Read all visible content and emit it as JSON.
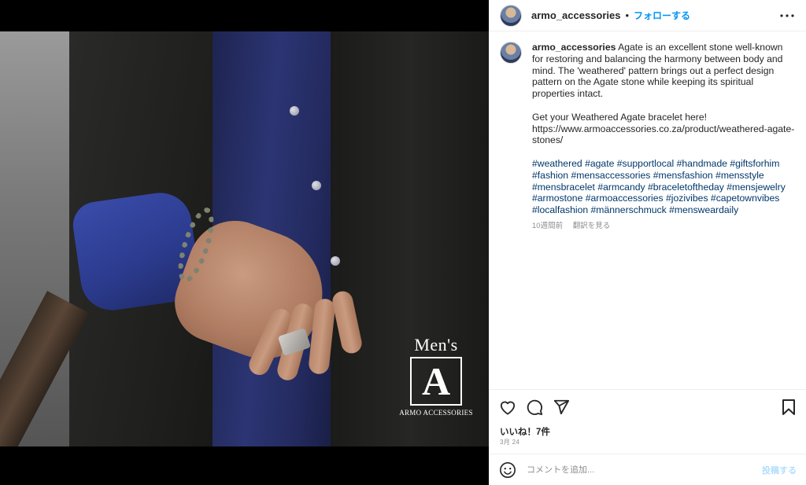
{
  "post": {
    "image_alt": "Men's hand wearing Weathered Agate bracelet and silver ring",
    "logo": {
      "line1": "Men's",
      "mark": "A",
      "brand": "ARMO ACCESSORIES"
    }
  },
  "header": {
    "username": "armo_accessories",
    "separator": "•",
    "follow_label": "フォローする",
    "more_icon": "more-horizontal-icon"
  },
  "caption": {
    "username": "armo_accessories",
    "lines": [
      "Agate is an excellent stone well-known for restoring and balancing the harmony between body and mind. The 'weathered' pattern brings out a perfect design pattern on the Agate stone while keeping its spiritual properties intact.",
      "Get your Weathered Agate bracelet here!",
      "https://www.armoaccessories.co.za/product/weathered-agate-stones/"
    ],
    "hashtags": "#weathered #agate #supportlocal #handmade #giftsforhim #fashion #mensaccessories #mensfashion #mensstyle #mensbracelet #armcandy #braceletoftheday #mensjewelry #armostone #armoaccessories #jozivibes #capetownvibes #localfashion #männerschmuck #mensweardaily",
    "time_ago": "10週間前",
    "translate_label": "翻訳を見る"
  },
  "actions": {
    "like_icon": "heart-icon",
    "comment_icon": "comment-icon",
    "share_icon": "send-icon",
    "save_icon": "bookmark-icon",
    "likes_text": "いいね！7件",
    "date_text": "3月 24"
  },
  "comment_box": {
    "emoji_icon": "emoji-icon",
    "placeholder": "コメントを追加...",
    "post_label": "投稿する"
  },
  "colors": {
    "link_blue": "#0095f6",
    "hashtag": "#00376b",
    "muted": "#8e8e8e",
    "post_disabled": "#b2dffc"
  }
}
